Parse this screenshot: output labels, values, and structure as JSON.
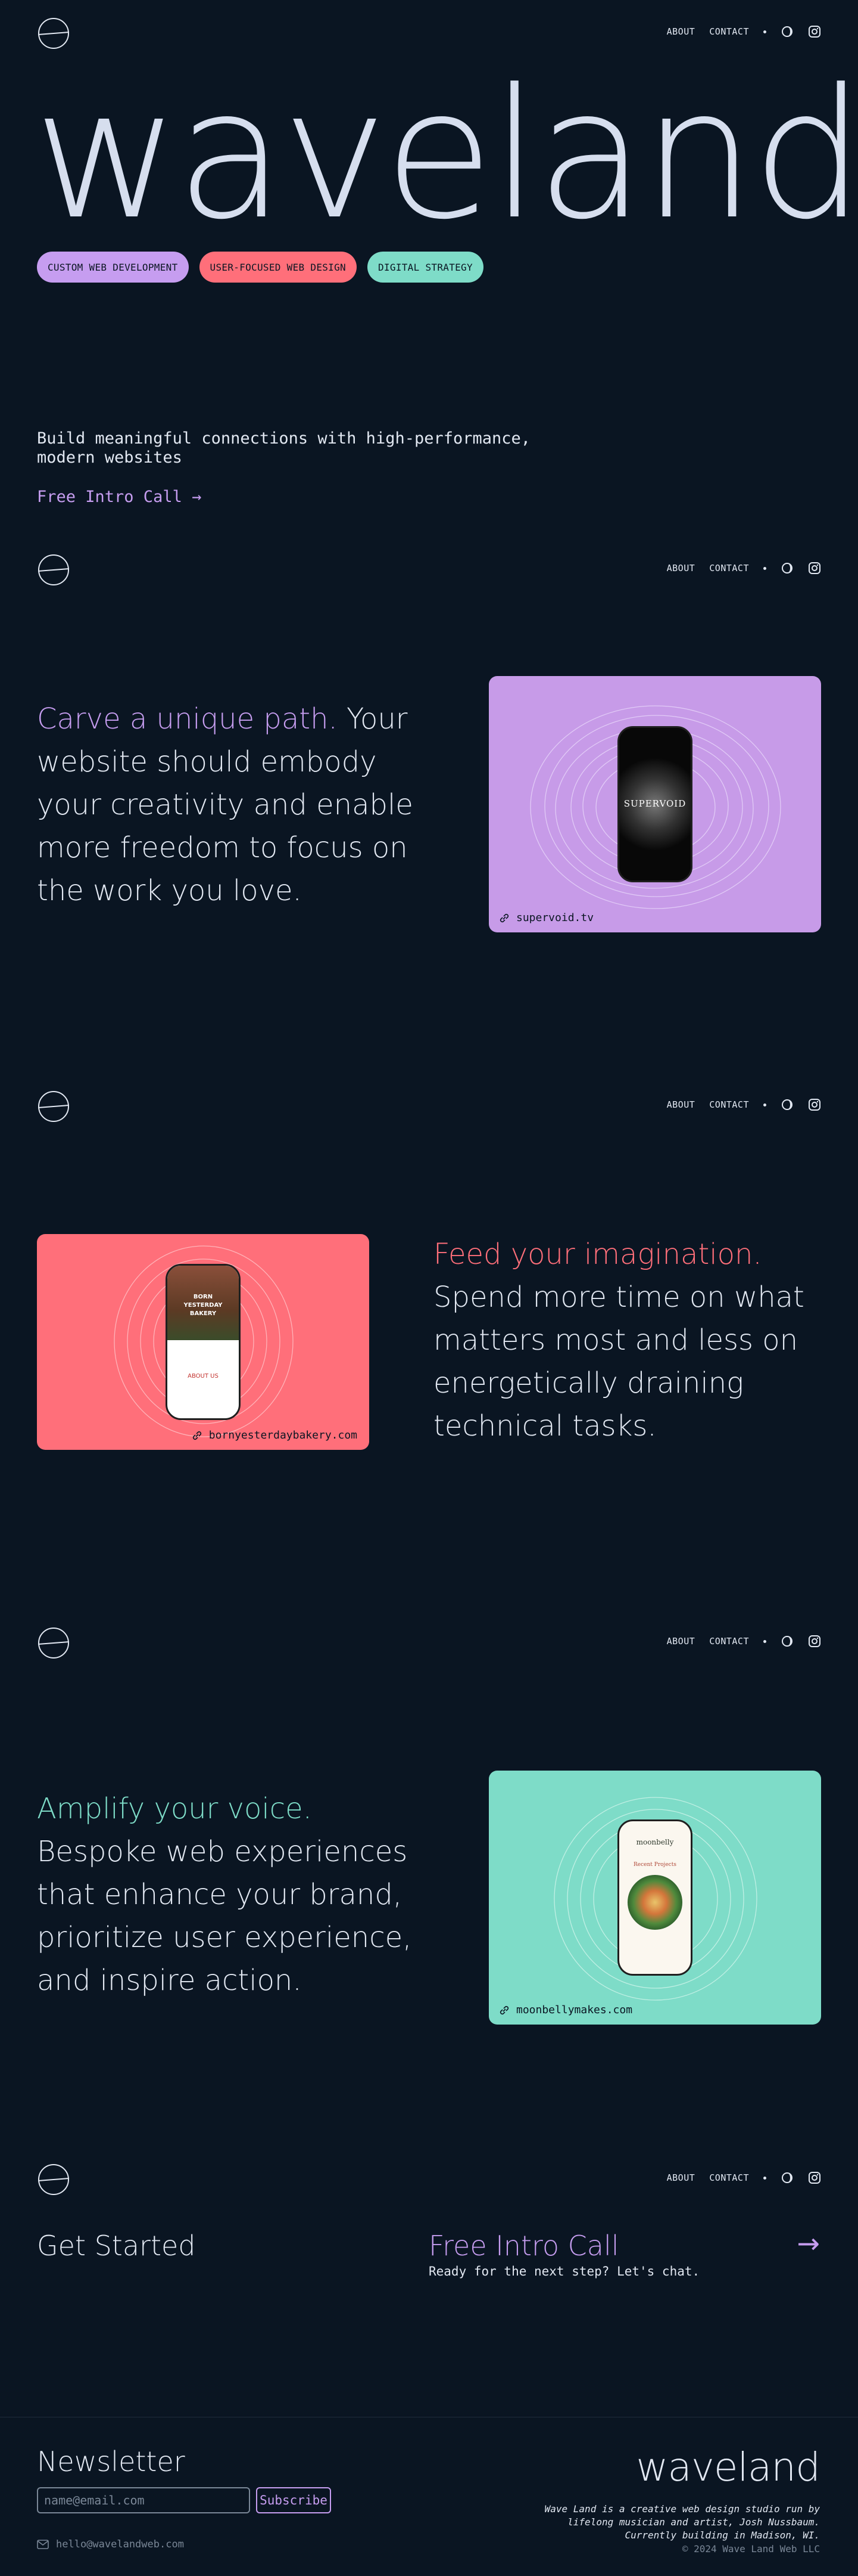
{
  "nav": {
    "about": "ABOUT",
    "contact": "CONTACT"
  },
  "hero": {
    "title": "waveland",
    "pills": [
      {
        "label": "CUSTOM WEB DEVELOPMENT",
        "color": "#c69df0"
      },
      {
        "label": "USER-FOCUSED WEB DESIGN",
        "color": "#ff6f7a"
      },
      {
        "label": "DIGITAL STRATEGY",
        "color": "#7edcc8"
      }
    ],
    "tagline_line1": "Build meaningful connections with high-performance,",
    "tagline_line2": "modern websites",
    "cta": "Free Intro Call →"
  },
  "section1": {
    "highlight": "Carve a unique path.",
    "text": " Your website should embody your creativity and enable more freedom to focus on the work you love.",
    "highlight_color": "#c69df0",
    "card_color": "#c79be8",
    "link": "supervoid.tv",
    "phone_title": "SUPERVOID"
  },
  "section2": {
    "highlight": "Feed your imagination.",
    "text": " Spend more time on what matters most and less on energetically draining technical tasks.",
    "highlight_color": "#ff6f7a",
    "card_color": "#ff6f7a",
    "link": "bornyesterdaybakery.com",
    "phone_title": "BORN YESTERDAY BAKERY",
    "phone_sub": "ABOUT US"
  },
  "section3": {
    "highlight": "Amplify your voice.",
    "text": " Bespoke web experiences that enhance your brand, prioritize user experience, and inspire action.",
    "highlight_color": "#7edcc8",
    "card_color": "#7edcc8",
    "link": "moonbellymakes.com",
    "phone_title": "moonbelly",
    "phone_sub": "Recent Projects"
  },
  "get_started": {
    "title": "Get Started",
    "cta": "Free Intro Call",
    "sub": "Ready for the next step? Let's chat.",
    "arrow": "→"
  },
  "footer": {
    "newsletter": "Newsletter",
    "placeholder": "name@email.com",
    "subscribe": "Subscribe",
    "email": "hello@wavelandweb.com",
    "logo": "waveland",
    "desc": "Wave Land is a creative web design studio run by lifelong musician and artist, Josh Nussbaum. Currently building in Madison, WI.",
    "copyright": "© 2024 Wave Land Web LLC"
  }
}
